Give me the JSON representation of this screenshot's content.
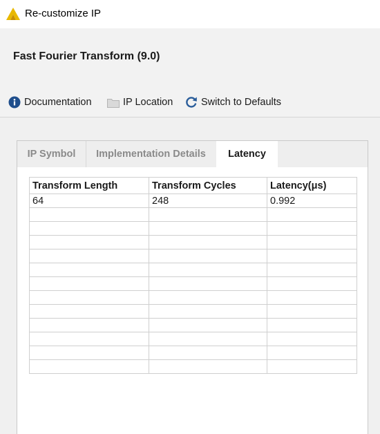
{
  "window": {
    "title": "Re-customize IP"
  },
  "header": {
    "ip_name": "Fast Fourier Transform (9.0)",
    "toolbar": {
      "documentation": "Documentation",
      "ip_location": "IP Location",
      "switch_defaults": "Switch to Defaults"
    }
  },
  "tabs": [
    {
      "label": "IP Symbol",
      "active": false
    },
    {
      "label": "Implementation Details",
      "active": false
    },
    {
      "label": "Latency",
      "active": true
    }
  ],
  "latency_table": {
    "headers": [
      "Transform Length",
      "Transform Cycles",
      "Latency(μs)"
    ],
    "rows": [
      [
        "64",
        "248",
        "0.992"
      ],
      [
        "",
        "",
        ""
      ],
      [
        "",
        "",
        ""
      ],
      [
        "",
        "",
        ""
      ],
      [
        "",
        "",
        ""
      ],
      [
        "",
        "",
        ""
      ],
      [
        "",
        "",
        ""
      ],
      [
        "",
        "",
        ""
      ],
      [
        "",
        "",
        ""
      ],
      [
        "",
        "",
        ""
      ],
      [
        "",
        "",
        ""
      ],
      [
        "",
        "",
        ""
      ],
      [
        "",
        "",
        ""
      ]
    ]
  },
  "colors": {
    "logo": "#e8b800",
    "info_icon": "#1f4e8c",
    "refresh_icon": "#2a5d9a"
  }
}
